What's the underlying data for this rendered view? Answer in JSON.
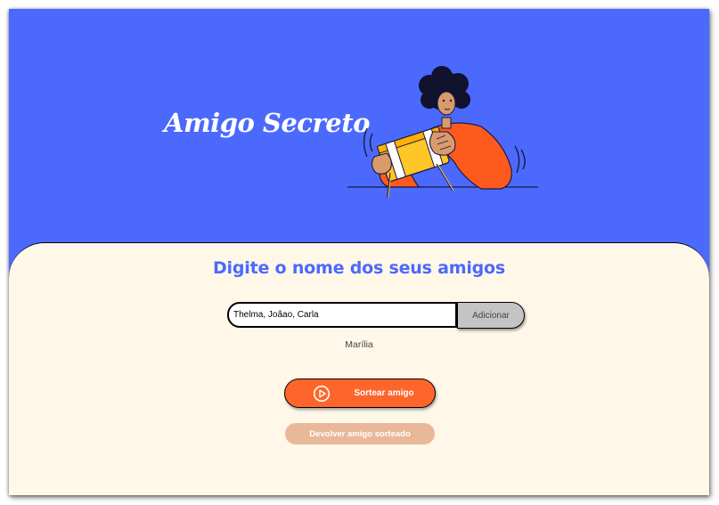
{
  "header": {
    "title": "Amigo Secreto"
  },
  "main": {
    "subtitle": "Digite o nome dos seus amigos",
    "name_input": {
      "value": "Thelma, Joãao, Carla",
      "placeholder": ""
    },
    "add_button_label": "Adicionar",
    "friends": [
      "Marília"
    ],
    "draw_button_label": "Sortear amigo",
    "reset_button_label": "Devolver amigo sorteado"
  },
  "icons": {
    "draw": "play-circle-icon",
    "illustration": "person-with-gift-illustration"
  },
  "colors": {
    "header_background": "#4b69fd",
    "panel_background": "#fff7e8",
    "accent_blue": "#4b69fd",
    "primary_orange": "#fe652b",
    "disabled_orange": "#e9b899",
    "add_button_gray": "#c4c4c4"
  }
}
